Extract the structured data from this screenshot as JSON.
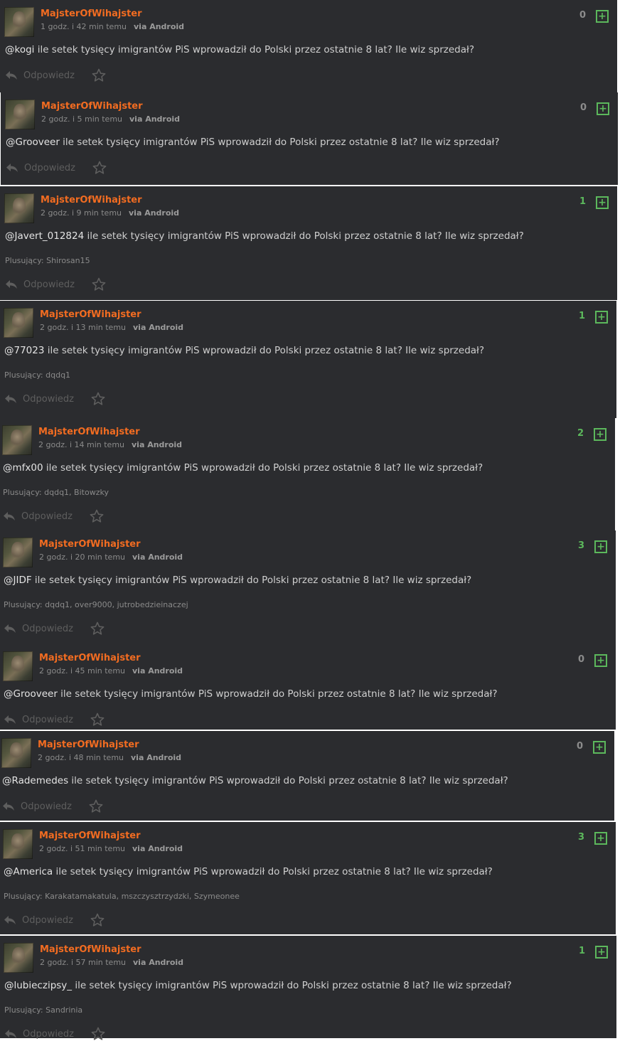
{
  "reply_label": "Odpowiedz",
  "plusers_label": "Plusujący:",
  "via_label": "via Android",
  "comments": [
    {
      "user": "MajsterOfWihajster",
      "time": "1 godz. i 42 min temu",
      "votes": "0",
      "mention": "@kogi",
      "text": " ile setek tysięcy imigrantów PiS wprowadził do Polski przez ostatnie 8 lat? Ile wiz sprzedał?",
      "plusers": ""
    },
    {
      "user": "MajsterOfWihajster",
      "time": "2 godz. i 5 min temu",
      "votes": "0",
      "mention": "@Grooveer",
      "text": " ile setek tysięcy imigrantów PiS wprowadził do Polski przez ostatnie 8 lat? Ile wiz sprzedał?",
      "plusers": ""
    },
    {
      "user": "MajsterOfWihajster",
      "time": "2 godz. i 9 min temu",
      "votes": "1",
      "mention": "@Javert_012824",
      "text": " ile setek tysięcy imigrantów PiS wprowadził do Polski przez ostatnie 8 lat? Ile wiz sprzedał?",
      "plusers": "Shirosan15"
    },
    {
      "user": "MajsterOfWihajster",
      "time": "2 godz. i 13 min temu",
      "votes": "1",
      "mention": "@77023",
      "text": " ile setek tysięcy imigrantów PiS wprowadził do Polski przez ostatnie 8 lat? Ile wiz sprzedał?",
      "plusers": "dqdq1"
    },
    {
      "user": "MajsterOfWihajster",
      "time": "2 godz. i 14 min temu",
      "votes": "2",
      "mention": "@mfx00",
      "text": " ile setek tysięcy imigrantów PiS wprowadził do Polski przez ostatnie 8 lat? Ile wiz sprzedał?",
      "plusers": "dqdq1, Bitowzky"
    },
    {
      "user": "MajsterOfWihajster",
      "time": "2 godz. i 20 min temu",
      "votes": "3",
      "mention": "@JIDF",
      "text": " ile setek tysięcy imigrantów PiS wprowadził do Polski przez ostatnie 8 lat? Ile wiz sprzedał?",
      "plusers": "dqdq1, over9000, jutrobedzieinaczej"
    },
    {
      "user": "MajsterOfWihajster",
      "time": "2 godz. i 45 min temu",
      "votes": "0",
      "mention": "@Grooveer",
      "text": " ile setek tysięcy imigrantów PiS wprowadził do Polski przez ostatnie 8 lat? Ile wiz sprzedał?",
      "plusers": ""
    },
    {
      "user": "MajsterOfWihajster",
      "time": "2 godz. i 48 min temu",
      "votes": "0",
      "mention": "@Rademedes",
      "text": " ile setek tysięcy imigrantów PiS wprowadził do Polski przez ostatnie 8 lat? Ile wiz sprzedał?",
      "plusers": ""
    },
    {
      "user": "MajsterOfWihajster",
      "time": "2 godz. i 51 min temu",
      "votes": "3",
      "mention": "@America",
      "text": " ile setek tysięcy imigrantów PiS wprowadził do Polski przez ostatnie 8 lat? Ile wiz sprzedał?",
      "plusers": "Karakatamakatula, mszczysztrzydzki, Szymeonee"
    },
    {
      "user": "MajsterOfWihajster",
      "time": "2 godz. i 57 min temu",
      "votes": "1",
      "mention": "@lubieczipsy_",
      "text": " ile setek tysięcy imigrantów PiS wprowadził do Polski przez ostatnie 8 lat? Ile wiz sprzedał?",
      "plusers": "Sandrinia"
    }
  ]
}
